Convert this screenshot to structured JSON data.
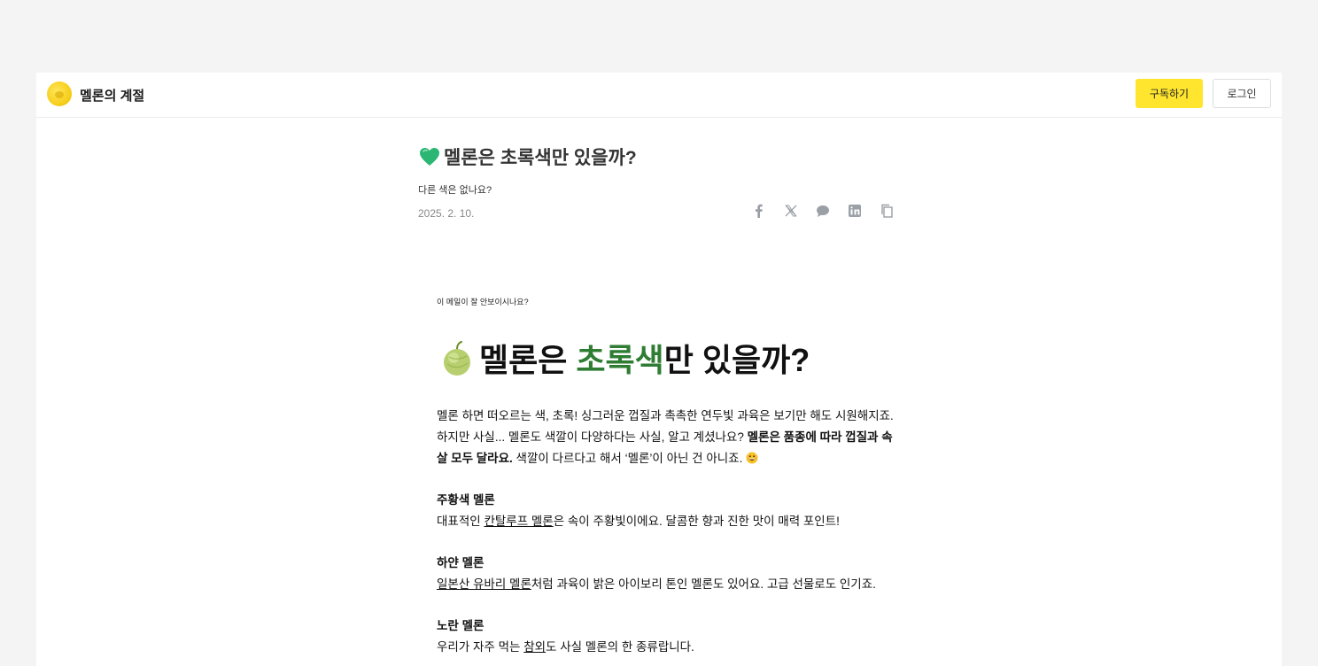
{
  "header": {
    "brand": "멜론의 계절",
    "subscribe_label": "구독하기",
    "login_label": "로그인",
    "brand_color": "#ffe52e"
  },
  "post": {
    "title": "멜론은 초록색만 있을까?",
    "subtitle": "다른 색은 없나요?",
    "date": "2025. 2. 10.",
    "share_icons": [
      "facebook-icon",
      "x-icon",
      "comment-icon",
      "linkedin-icon",
      "copy-icon"
    ]
  },
  "newsletter": {
    "notice": "이 메일이 잘 안보이시나요?",
    "heading": {
      "part1": "멜론은 ",
      "highlight": "초록색",
      "part2": "만 있을까?",
      "highlight_color": "#2e7d32"
    },
    "intro": {
      "line1": "멜론 하면 떠오르는 색, 초록! 싱그러운 껍질과 촉촉한 연두빛 과육은 보기만 해도 시원해지죠.",
      "line2a": "하지만 사실... 멜론도 색깔이 다양하다는 사실, 알고 계셨나요? ",
      "line2b_bold": "멜론은 품종에 따라 껍질과 속",
      "line3_bold": "살 모두 달라요.",
      "line3_rest": " 색깔이 다르다고 해서 ‘멜론’이 아닌 건 아니죠."
    },
    "sections": [
      {
        "title": "주황색 멜론",
        "link": "칸탈루프 멜론",
        "text_before": "대표적인 ",
        "text_after": "은 속이 주황빛이에요. 달콤한 향과 진한 맛이 매력 포인트!"
      },
      {
        "title": "하얀 멜론",
        "link": "일본산 유바리 멜론",
        "text_before": "",
        "text_after": "처럼 과육이 밝은 아이보리 톤인 멜론도 있어요. 고급 선물로도 인기죠."
      },
      {
        "title": "노란 멜론",
        "link": "참외",
        "text_before": "우리가 자주 먹는 ",
        "text_after": "도 사실 멜론의 한 종류랍니다."
      }
    ]
  }
}
